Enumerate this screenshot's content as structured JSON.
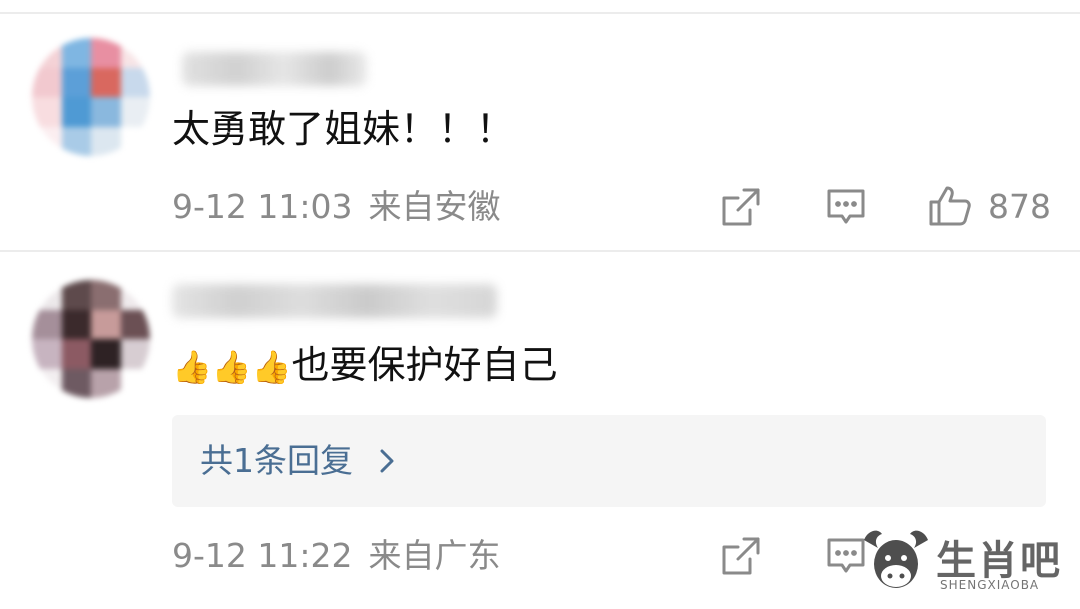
{
  "comments": [
    {
      "text": "太勇敢了姐妹！！！",
      "date": "9-12 11:03",
      "location": "来自安徽",
      "likes": "878"
    },
    {
      "emojis": [
        "👍",
        "👍",
        "👍"
      ],
      "text": "也要保护好自己",
      "date": "9-12 11:22",
      "location": "来自广东",
      "reply_link": "共1条回复"
    }
  ],
  "watermark": {
    "title": "生肖吧",
    "subtitle": "SHENGXIAOBA"
  },
  "icons": [
    "share-icon",
    "comment-icon",
    "like-icon",
    "chevron-right-icon"
  ],
  "colors": {
    "meta_gray": "#8a8a8a",
    "reply_link_blue": "#4a6e93",
    "reply_bg": "#f5f5f5"
  }
}
